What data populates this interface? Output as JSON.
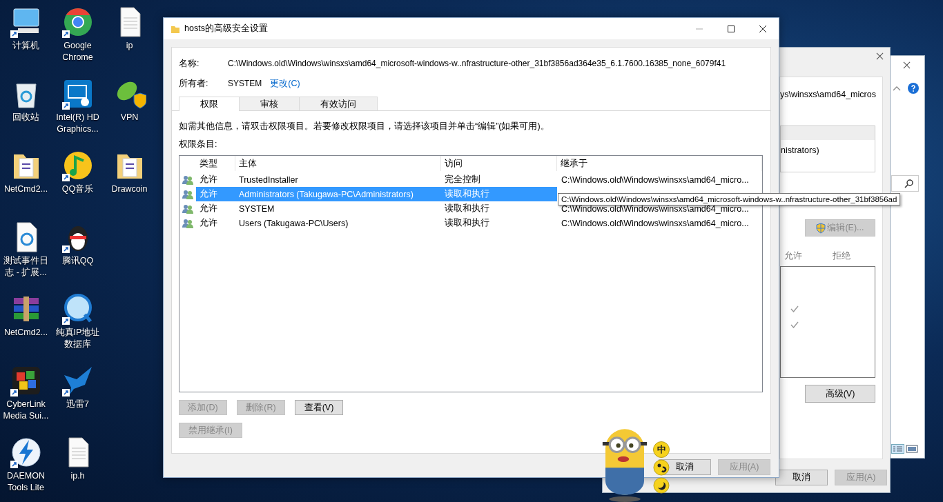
{
  "desktop": {
    "icons": [
      {
        "kind": "computer",
        "label": "计算机",
        "shortcut": true
      },
      {
        "kind": "recycle",
        "label": "回收站",
        "shortcut": false
      },
      {
        "kind": "folder",
        "label": "NetCmd2...",
        "shortcut": false
      },
      {
        "kind": "web-doc",
        "label": "测试事件日志 - 扩展...",
        "shortcut": false
      },
      {
        "kind": "archive",
        "label": "NetCmd2...",
        "shortcut": false
      },
      {
        "kind": "puzzle",
        "label": "CyberLink Media Sui...",
        "shortcut": true
      },
      {
        "kind": "disc",
        "label": "DAEMON Tools Lite",
        "shortcut": true
      },
      {
        "kind": "browser",
        "label": "Google Chrome",
        "shortcut": true
      },
      {
        "kind": "display-app",
        "label": "Intel(R) HD Graphics...",
        "shortcut": true
      },
      {
        "kind": "music",
        "label": "QQ音乐",
        "shortcut": true
      },
      {
        "kind": "penguin",
        "label": "腾讯QQ",
        "shortcut": true
      },
      {
        "kind": "quicktime",
        "label": "纯真IP地址数据库",
        "shortcut": true
      },
      {
        "kind": "bird",
        "label": "迅雷7",
        "shortcut": true
      },
      {
        "kind": "document",
        "label": "ip.h",
        "shortcut": false
      },
      {
        "kind": "document",
        "label": "ip",
        "shortcut": false
      },
      {
        "kind": "vpn",
        "label": "VPN",
        "shortcut": false
      },
      {
        "kind": "folder",
        "label": "Drawcoin",
        "shortcut": false
      }
    ]
  },
  "back_window": {
    "path": "ys\\winsxs\\amd64_micros",
    "list_text": "nistrators)",
    "edit_button": {
      "label": "编辑(E)...",
      "disabled": true
    },
    "columns": [
      "允许",
      "拒绝"
    ],
    "checks": [
      {
        "allow": true
      },
      {
        "allow": true
      }
    ],
    "advanced_button": "高级(V)",
    "buttons": [
      {
        "label": "取消",
        "disabled": false
      },
      {
        "label": "应用(A)",
        "disabled": true
      }
    ]
  },
  "main_window": {
    "title": "hosts的高级安全设置",
    "name_label": "名称:",
    "name_value": "C:\\Windows.old\\Windows\\winsxs\\amd64_microsoft-windows-w..nfrastructure-other_31bf3856ad364e35_6.1.7600.16385_none_6079f41",
    "owner_label": "所有者:",
    "owner_value": "SYSTEM",
    "change_link": "更改(C)",
    "tabs": [
      {
        "label": "权限",
        "selected": true
      },
      {
        "label": "审核",
        "selected": false
      },
      {
        "label": "有效访问",
        "selected": false
      }
    ],
    "info_text": "如需其他信息，请双击权限项目。若要修改权限项目，请选择该项目并单击“编辑”(如果可用)。",
    "entries_label": "权限条目:",
    "table": {
      "columns": [
        "类型",
        "主体",
        "访问",
        "继承于"
      ],
      "rows": [
        {
          "type": "允许",
          "principal": "TrustedInstaller",
          "access": "完全控制",
          "inherited_from": "C:\\Windows.old\\Windows\\winsxs\\amd64_micro...",
          "selected": false
        },
        {
          "type": "允许",
          "principal": "Administrators (Takugawa-PC\\Administrators)",
          "access": "读取和执行",
          "selected": true
        },
        {
          "type": "允许",
          "principal": "SYSTEM",
          "access": "读取和执行",
          "inherited_from": "C:\\Windows.old\\Windows\\winsxs\\amd64_micro...",
          "selected": false
        },
        {
          "type": "允许",
          "principal": "Users (Takugawa-PC\\Users)",
          "access": "读取和执行",
          "inherited_from": "C:\\Windows.old\\Windows\\winsxs\\amd64_micro...",
          "selected": false
        }
      ]
    },
    "tooltip": "C:\\Windows.old\\Windows\\winsxs\\amd64_microsoft-windows-w..nfrastructure-other_31bf3856ad",
    "buttons": [
      {
        "label": "添加(D)",
        "disabled": true
      },
      {
        "label": "删除(R)",
        "disabled": true
      },
      {
        "label": "查看(V)",
        "disabled": false
      }
    ],
    "inherit_button": {
      "label": "禁用继承(I)",
      "disabled": true
    },
    "footer_buttons": [
      {
        "label": "取消",
        "disabled": false
      },
      {
        "label": "应用(A)",
        "disabled": true
      }
    ]
  },
  "ime": {
    "mode": "中"
  }
}
